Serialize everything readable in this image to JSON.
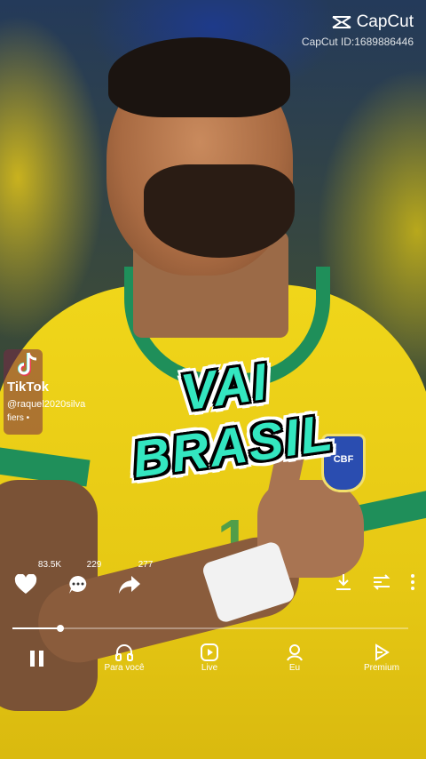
{
  "watermark": {
    "brand": "CapCut",
    "id_text": "CapCut ID:1689886446"
  },
  "tiktok_badge": {
    "logo_text": "TikTok",
    "username": "@raquel2020silva",
    "followers_label": "fiers •"
  },
  "caption": {
    "text": "VAI BRASIL",
    "color": "#33e6c0"
  },
  "crest_text": "CBF",
  "actions": {
    "likes": "83.5K",
    "comments": "229",
    "shares": "277"
  },
  "progress": 0.12,
  "nav": {
    "items": [
      {
        "label": "Para você",
        "icon": "headphones-icon"
      },
      {
        "label": "Live",
        "icon": "play-circle-icon"
      },
      {
        "label": "Eu",
        "icon": "person-icon"
      },
      {
        "label": "Premium",
        "icon": "premium-icon"
      }
    ]
  }
}
